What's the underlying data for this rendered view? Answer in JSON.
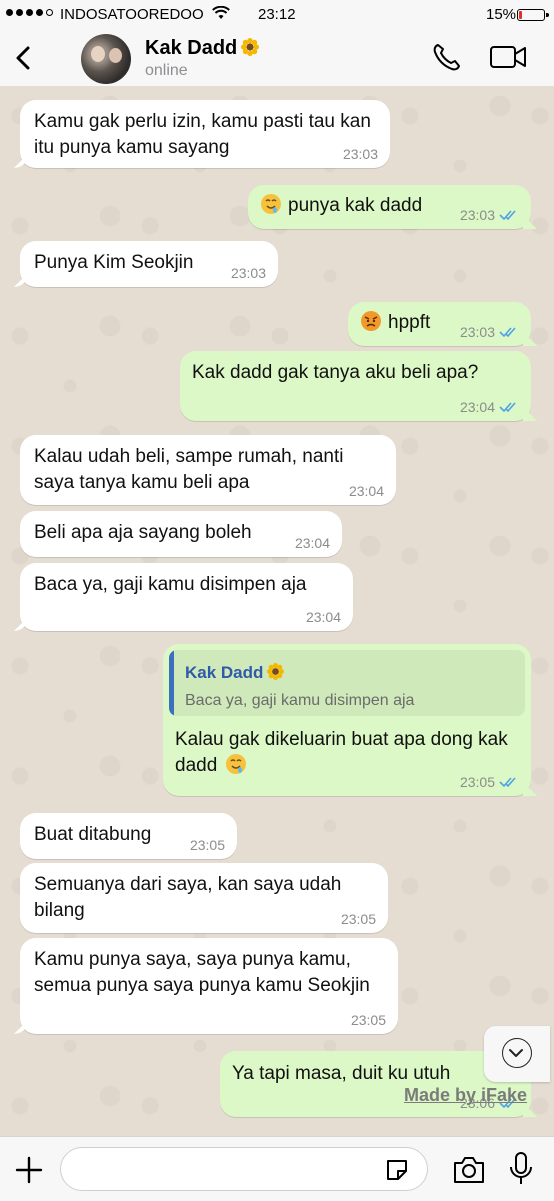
{
  "status_bar": {
    "carrier": "INDOSATOOREDOO",
    "time": "23:12",
    "battery_percent": "15%",
    "battery_level": 0.15,
    "signal_dots_filled": 4
  },
  "header": {
    "contact_name": "Kak Dadd",
    "presence": "online"
  },
  "messages": [
    {
      "dir": "in",
      "text": "Kamu gak perlu izin, kamu pasti tau kan itu punya kamu sayang",
      "time": "23:03"
    },
    {
      "dir": "out",
      "emoji": "drooling",
      "text": "punya kak dadd",
      "time": "23:03",
      "read": true
    },
    {
      "dir": "in",
      "text": "Punya Kim Seokjin",
      "time": "23:03"
    },
    {
      "dir": "out",
      "emoji": "angry",
      "text": "hppft",
      "time": "23:03",
      "read": true
    },
    {
      "dir": "out",
      "text": "Kak dadd gak tanya aku beli apa?",
      "time": "23:04",
      "read": true
    },
    {
      "dir": "in",
      "text": "Kalau udah beli, sampe rumah, nanti saya tanya kamu beli apa",
      "time": "23:04"
    },
    {
      "dir": "in",
      "text": "Beli apa aja sayang boleh",
      "time": "23:04"
    },
    {
      "dir": "in",
      "text": "Baca ya, gaji kamu disimpen aja",
      "time": "23:04"
    },
    {
      "dir": "out",
      "quote": {
        "name": "Kak Dadd",
        "text": "Baca ya, gaji kamu disimpen aja"
      },
      "text": "Kalau gak dikeluarin buat apa dong kak dadd",
      "emoji_after": "drooling",
      "time": "23:05",
      "read": true
    },
    {
      "dir": "in",
      "text": "Buat ditabung",
      "time": "23:05"
    },
    {
      "dir": "in",
      "text": "Semuanya dari saya, kan saya udah bilang",
      "time": "23:05"
    },
    {
      "dir": "in",
      "text": "Kamu punya saya, saya punya kamu, semua punya saya punya kamu Seokjin",
      "time": "23:05"
    },
    {
      "dir": "out",
      "text": "Ya tapi masa, duit ku utuh",
      "time": "23:06",
      "read": true
    }
  ],
  "watermark": "Made by iFake",
  "colors": {
    "incoming_bubble": "#ffffff",
    "outgoing_bubble": "#dcf8c6",
    "read_tick": "#4fa3e3",
    "wallpaper": "#e6ddd2"
  }
}
